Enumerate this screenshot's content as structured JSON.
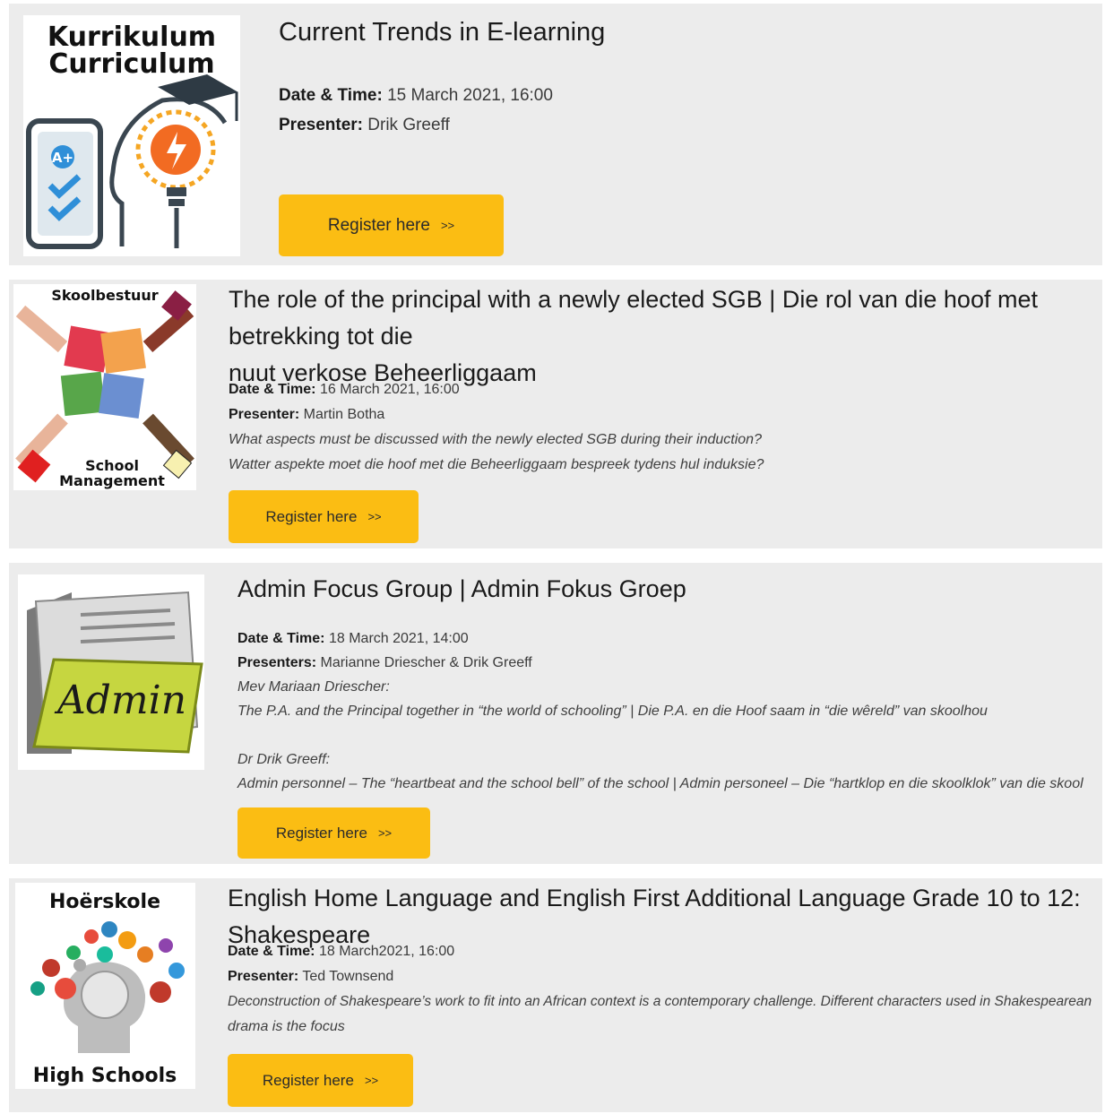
{
  "events": [
    {
      "thumb": {
        "line1": "Kurrikulum",
        "line2": "Curriculum"
      },
      "title": "Current Trends in E-learning",
      "date_label": "Date & Time:",
      "date_value": "15 March 2021, 16:00",
      "presenter_label": "Presenter:",
      "presenter_value": "Drik Greeff",
      "register_label": "Register here",
      "register_arrow": ">>"
    },
    {
      "thumb": {
        "top": "Skoolbestuur",
        "bottom1": "School",
        "bottom2": "Management"
      },
      "title_line1": "The role of the principal with a newly elected SGB | Die rol van die hoof met betrekking tot die",
      "title_line2": "nuut verkose Beheerliggaam",
      "date_label": "Date & Time:",
      "date_value": "16 March 2021, 16:00",
      "presenter_label": "Presenter:",
      "presenter_value": "Martin Botha",
      "desc1": "What aspects must be discussed with the newly elected SGB during their induction?",
      "desc2": "Watter aspekte moet die hoof met die Beheerliggaam bespreek tydens hul induksie?",
      "register_label": "Register here",
      "register_arrow": ">>"
    },
    {
      "thumb": {
        "label": "Admin"
      },
      "title": "Admin Focus Group | Admin Fokus Groep",
      "date_label": "Date & Time:",
      "date_value": "18 March 2021, 14:00",
      "presenter_label": "Presenters:",
      "presenter_value": "Marianne Driescher & Drik Greeff",
      "desc1": "Mev Mariaan Driescher:",
      "desc2": "The P.A. and the Principal together in “the world of schooling” | Die P.A. en die Hoof saam in “die wêreld” van skoolhou",
      "desc3": "Dr Drik Greeff:",
      "desc4": "Admin personnel – The “heartbeat and the school bell” of the school | Admin personeel – Die “hartklop en die skoolklok” van die skool",
      "register_label": "Register here",
      "register_arrow": ">>"
    },
    {
      "thumb": {
        "top": "Hoërskole",
        "bottom": "High Schools"
      },
      "title": "English Home Language and English First Additional Language Grade 10 to 12: Shakespeare",
      "date_label": "Date & Time:",
      "date_value": "18 March2021, 16:00",
      "presenter_label": "Presenter:",
      "presenter_value": "Ted Townsend",
      "desc1": "Deconstruction of Shakespeare’s work to fit into an African context is a contemporary challenge. Different characters used in Shakespearean",
      "desc2": "drama is the focus",
      "register_label": "Register here",
      "register_arrow": ">>"
    }
  ],
  "colors": {
    "card_bg": "#ececec",
    "button": "#fbbd13"
  }
}
